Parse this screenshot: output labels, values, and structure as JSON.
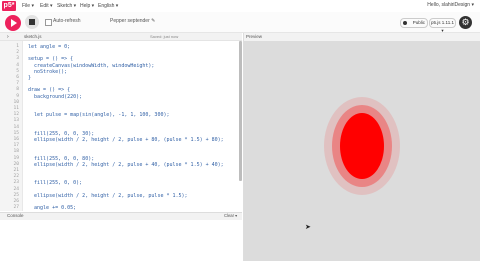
{
  "nav": {
    "logo": "p5*",
    "menus": [
      "File ▾",
      "Edit ▾",
      "Sketch ▾",
      "Help ▾",
      "English ▾"
    ],
    "user": "Hello, slahiriDesign ▾"
  },
  "toolbar": {
    "auto_refresh_label": "Auto-refresh",
    "auto_refresh_checked": false,
    "sketch_name": "Pepper septender ✎",
    "public_label": "Public",
    "version_label": "p5.js 1.11.1 ▾"
  },
  "editor": {
    "filename": "sketch.js",
    "sidebar_toggle": "›",
    "saved_status": "Saved: just now",
    "lines": [
      "let angle = 0;",
      "",
      "setup = () => {",
      "  createCanvas(windowWidth, windowHeight);",
      "  noStroke();",
      "}",
      "",
      "draw = () => {",
      "  background(220);",
      "",
      "",
      "  let pulse = map(sin(angle), -1, 1, 100, 300);",
      "",
      "",
      "  fill(255, 0, 0, 30);",
      "  ellipse(width / 2, height / 2, pulse + 80, (pulse * 1.5) + 80);",
      "",
      "",
      "  fill(255, 0, 0, 80);",
      "  ellipse(width / 2, height / 2, pulse + 40, (pulse * 1.5) + 40);",
      "",
      "",
      "  fill(255, 0, 0);",
      "",
      "  ellipse(width / 2, height / 2, pulse, pulse * 1.5);",
      "",
      "  angle += 0.05;",
      "}"
    ],
    "line_numbers": [
      "1",
      "2",
      "3",
      "4",
      "5",
      "6",
      "7",
      "8",
      "9",
      "10",
      "11",
      "12",
      "13",
      "14",
      "15",
      "16",
      "17",
      "18",
      "19",
      "20",
      "21",
      "22",
      "23",
      "24",
      "25",
      "26",
      "27"
    ]
  },
  "console": {
    "label": "Console",
    "clear_label": "Clear ▾"
  },
  "preview": {
    "label": "Preview",
    "background": "#dcdcdc",
    "ellipse_color": "#ff0000",
    "pulse_value": 110
  },
  "colors": {
    "accent": "#ed225d",
    "code": "#2f5fa5"
  },
  "icons": {
    "play": "play-icon",
    "stop": "stop-icon",
    "gear": "gear-icon"
  }
}
